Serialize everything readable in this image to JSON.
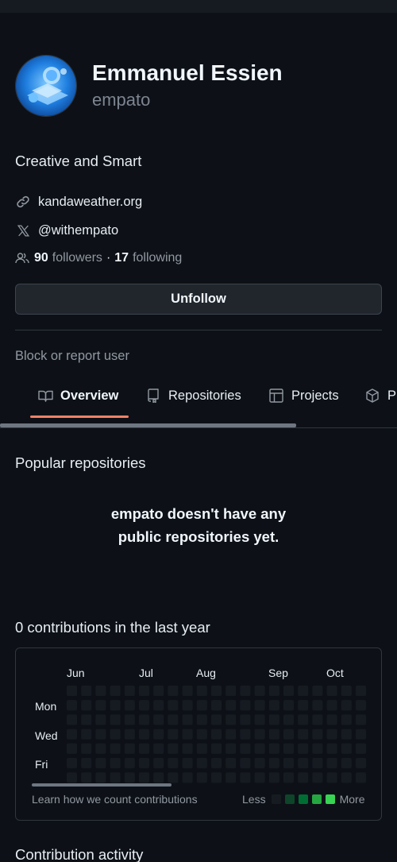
{
  "profile": {
    "name": "Emmanuel Essien",
    "login": "empato",
    "bio": "Creative and Smart",
    "website": "kandaweather.org",
    "x_handle": "@withempato",
    "followers_count": "90",
    "followers_label": "followers",
    "separator": "·",
    "following_count": "17",
    "following_label": "following",
    "unfollow_label": "Unfollow",
    "block_label": "Block or report user"
  },
  "tabs": [
    {
      "label": "Overview",
      "icon": "book-icon",
      "active": true
    },
    {
      "label": "Repositories",
      "icon": "repo-icon"
    },
    {
      "label": "Projects",
      "icon": "table-icon"
    },
    {
      "label": "P",
      "icon": "package-icon"
    }
  ],
  "popular": {
    "title": "Popular repositories",
    "empty_line1": "empato doesn't have any",
    "empty_line2": "public repositories yet."
  },
  "contributions": {
    "title": "0 contributions in the last year",
    "months": [
      "Jun",
      "Jul",
      "Aug",
      "Sep",
      "Oct"
    ],
    "days": [
      "Mon",
      "Wed",
      "Fri"
    ],
    "learn_label": "Learn how we count contributions",
    "less_label": "Less",
    "more_label": "More",
    "legend_colors": [
      "#161b22",
      "#0e4429",
      "#006d32",
      "#26a641",
      "#39d353"
    ],
    "cell_color": "#161b22",
    "weeks_visible": 21,
    "total": 0
  },
  "activity": {
    "title": "Contribution activity"
  },
  "colors": {
    "background": "#0d1117",
    "tab_underline": "#f78166",
    "muted": "#9198a1"
  }
}
